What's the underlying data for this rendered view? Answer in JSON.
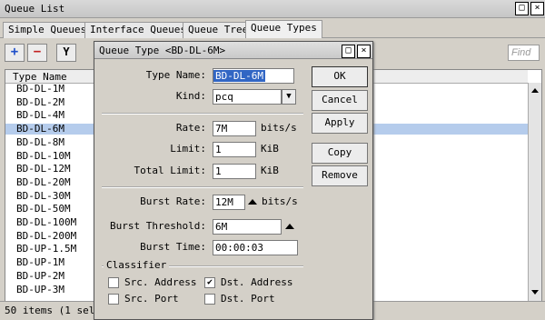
{
  "window": {
    "title": "Queue List",
    "restore_glyph": "□",
    "close_glyph": "×"
  },
  "tabs": [
    "Simple Queues",
    "Interface Queues",
    "Queue Tree",
    "Queue Types"
  ],
  "toolbar": {
    "add_glyph": "+",
    "remove_glyph": "−",
    "filter_glyph": "Y",
    "find_placeholder": "Find"
  },
  "list": {
    "column_header": "Type Name",
    "rows": [
      "BD-DL-1M",
      "BD-DL-2M",
      "BD-DL-4M",
      "BD-DL-6M",
      "BD-DL-8M",
      "BD-DL-10M",
      "BD-DL-12M",
      "BD-DL-20M",
      "BD-DL-30M",
      "BD-DL-50M",
      "BD-DL-100M",
      "BD-DL-200M",
      "BD-UP-1.5M",
      "BD-UP-1M",
      "BD-UP-2M",
      "BD-UP-3M"
    ],
    "selected_index": 3
  },
  "status": {
    "text": "50 items (1 sele"
  },
  "dialog": {
    "title": "Queue Type <BD-DL-6M>",
    "type_name_label": "Type Name:",
    "type_name_value": "BD-DL-6M",
    "kind_label": "Kind:",
    "kind_value": "pcq",
    "rate_label": "Rate:",
    "rate_value": "7M",
    "rate_unit": "bits/s",
    "limit_label": "Limit:",
    "limit_value": "1",
    "limit_unit": "KiB",
    "total_limit_label": "Total Limit:",
    "total_limit_value": "1",
    "total_limit_unit": "KiB",
    "burst_rate_label": "Burst Rate:",
    "burst_rate_value": "12M",
    "burst_rate_unit": "bits/s",
    "burst_threshold_label": "Burst Threshold:",
    "burst_threshold_value": "6M",
    "burst_time_label": "Burst Time:",
    "burst_time_value": "00:00:03",
    "classifier_label": "Classifier",
    "src_address_label": "Src. Address",
    "dst_address_label": "Dst. Address",
    "src_port_label": "Src. Port",
    "dst_port_label": "Dst. Port",
    "src_address_checked": false,
    "dst_address_checked": true,
    "src_port_checked": false,
    "dst_port_checked": false,
    "buttons": {
      "ok": "OK",
      "cancel": "Cancel",
      "apply": "Apply",
      "copy": "Copy",
      "remove": "Remove"
    }
  },
  "colors": {
    "selection": "#b5ccec",
    "highlight_text": "#ffffff",
    "highlight_bg": "#3166c4"
  }
}
